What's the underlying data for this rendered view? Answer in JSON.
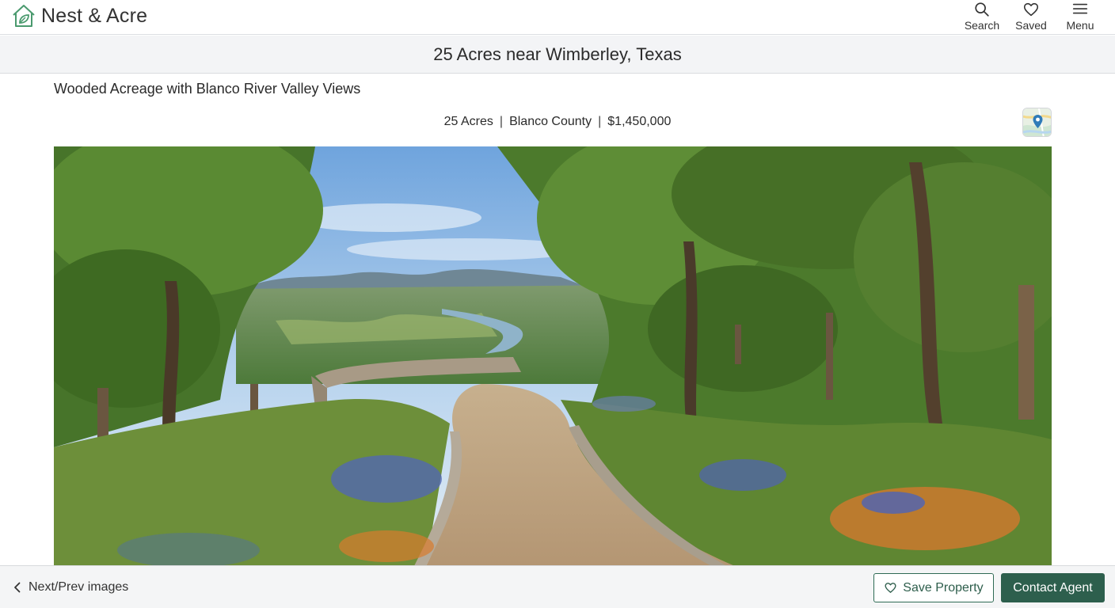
{
  "brand": {
    "name": "Nest & Acre",
    "logo_icon": "house-leaf-icon",
    "accent_color": "#4a9a6e"
  },
  "nav": {
    "items": [
      {
        "label": "Search",
        "icon": "search-icon"
      },
      {
        "label": "Saved",
        "icon": "heart-icon"
      },
      {
        "label": "Menu",
        "icon": "hamburger-menu-icon"
      }
    ]
  },
  "listing": {
    "title": "25 Acres near Wimberley, Texas",
    "subtitle": "Wooded Acreage with Blanco River Valley Views",
    "acres": "25 Acres",
    "county": "Blanco County",
    "price": "$1,450,000",
    "separator": "|",
    "map_icon": "map-pin-icon"
  },
  "footer": {
    "nextprev_label": "Next/Prev images",
    "save_label": "Save Property",
    "contact_label": "Contact Agent",
    "primary_color": "#2d5f4d"
  }
}
